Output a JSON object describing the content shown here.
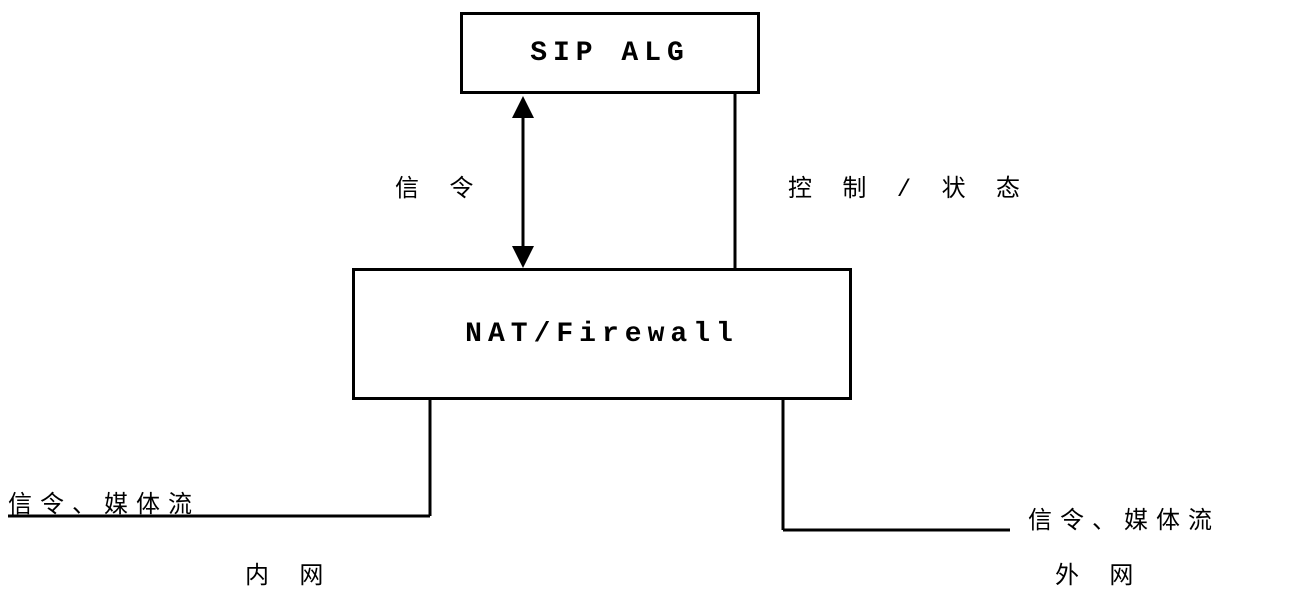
{
  "boxes": {
    "sip_alg": "SIP ALG",
    "nat_firewall": "NAT/Firewall"
  },
  "labels": {
    "signaling": "信 令",
    "control_status": "控 制 / 状 态",
    "left_flow": "信令、媒体流",
    "right_flow": "信令、媒体流",
    "inner_net": "内 网",
    "outer_net": "外 网"
  }
}
